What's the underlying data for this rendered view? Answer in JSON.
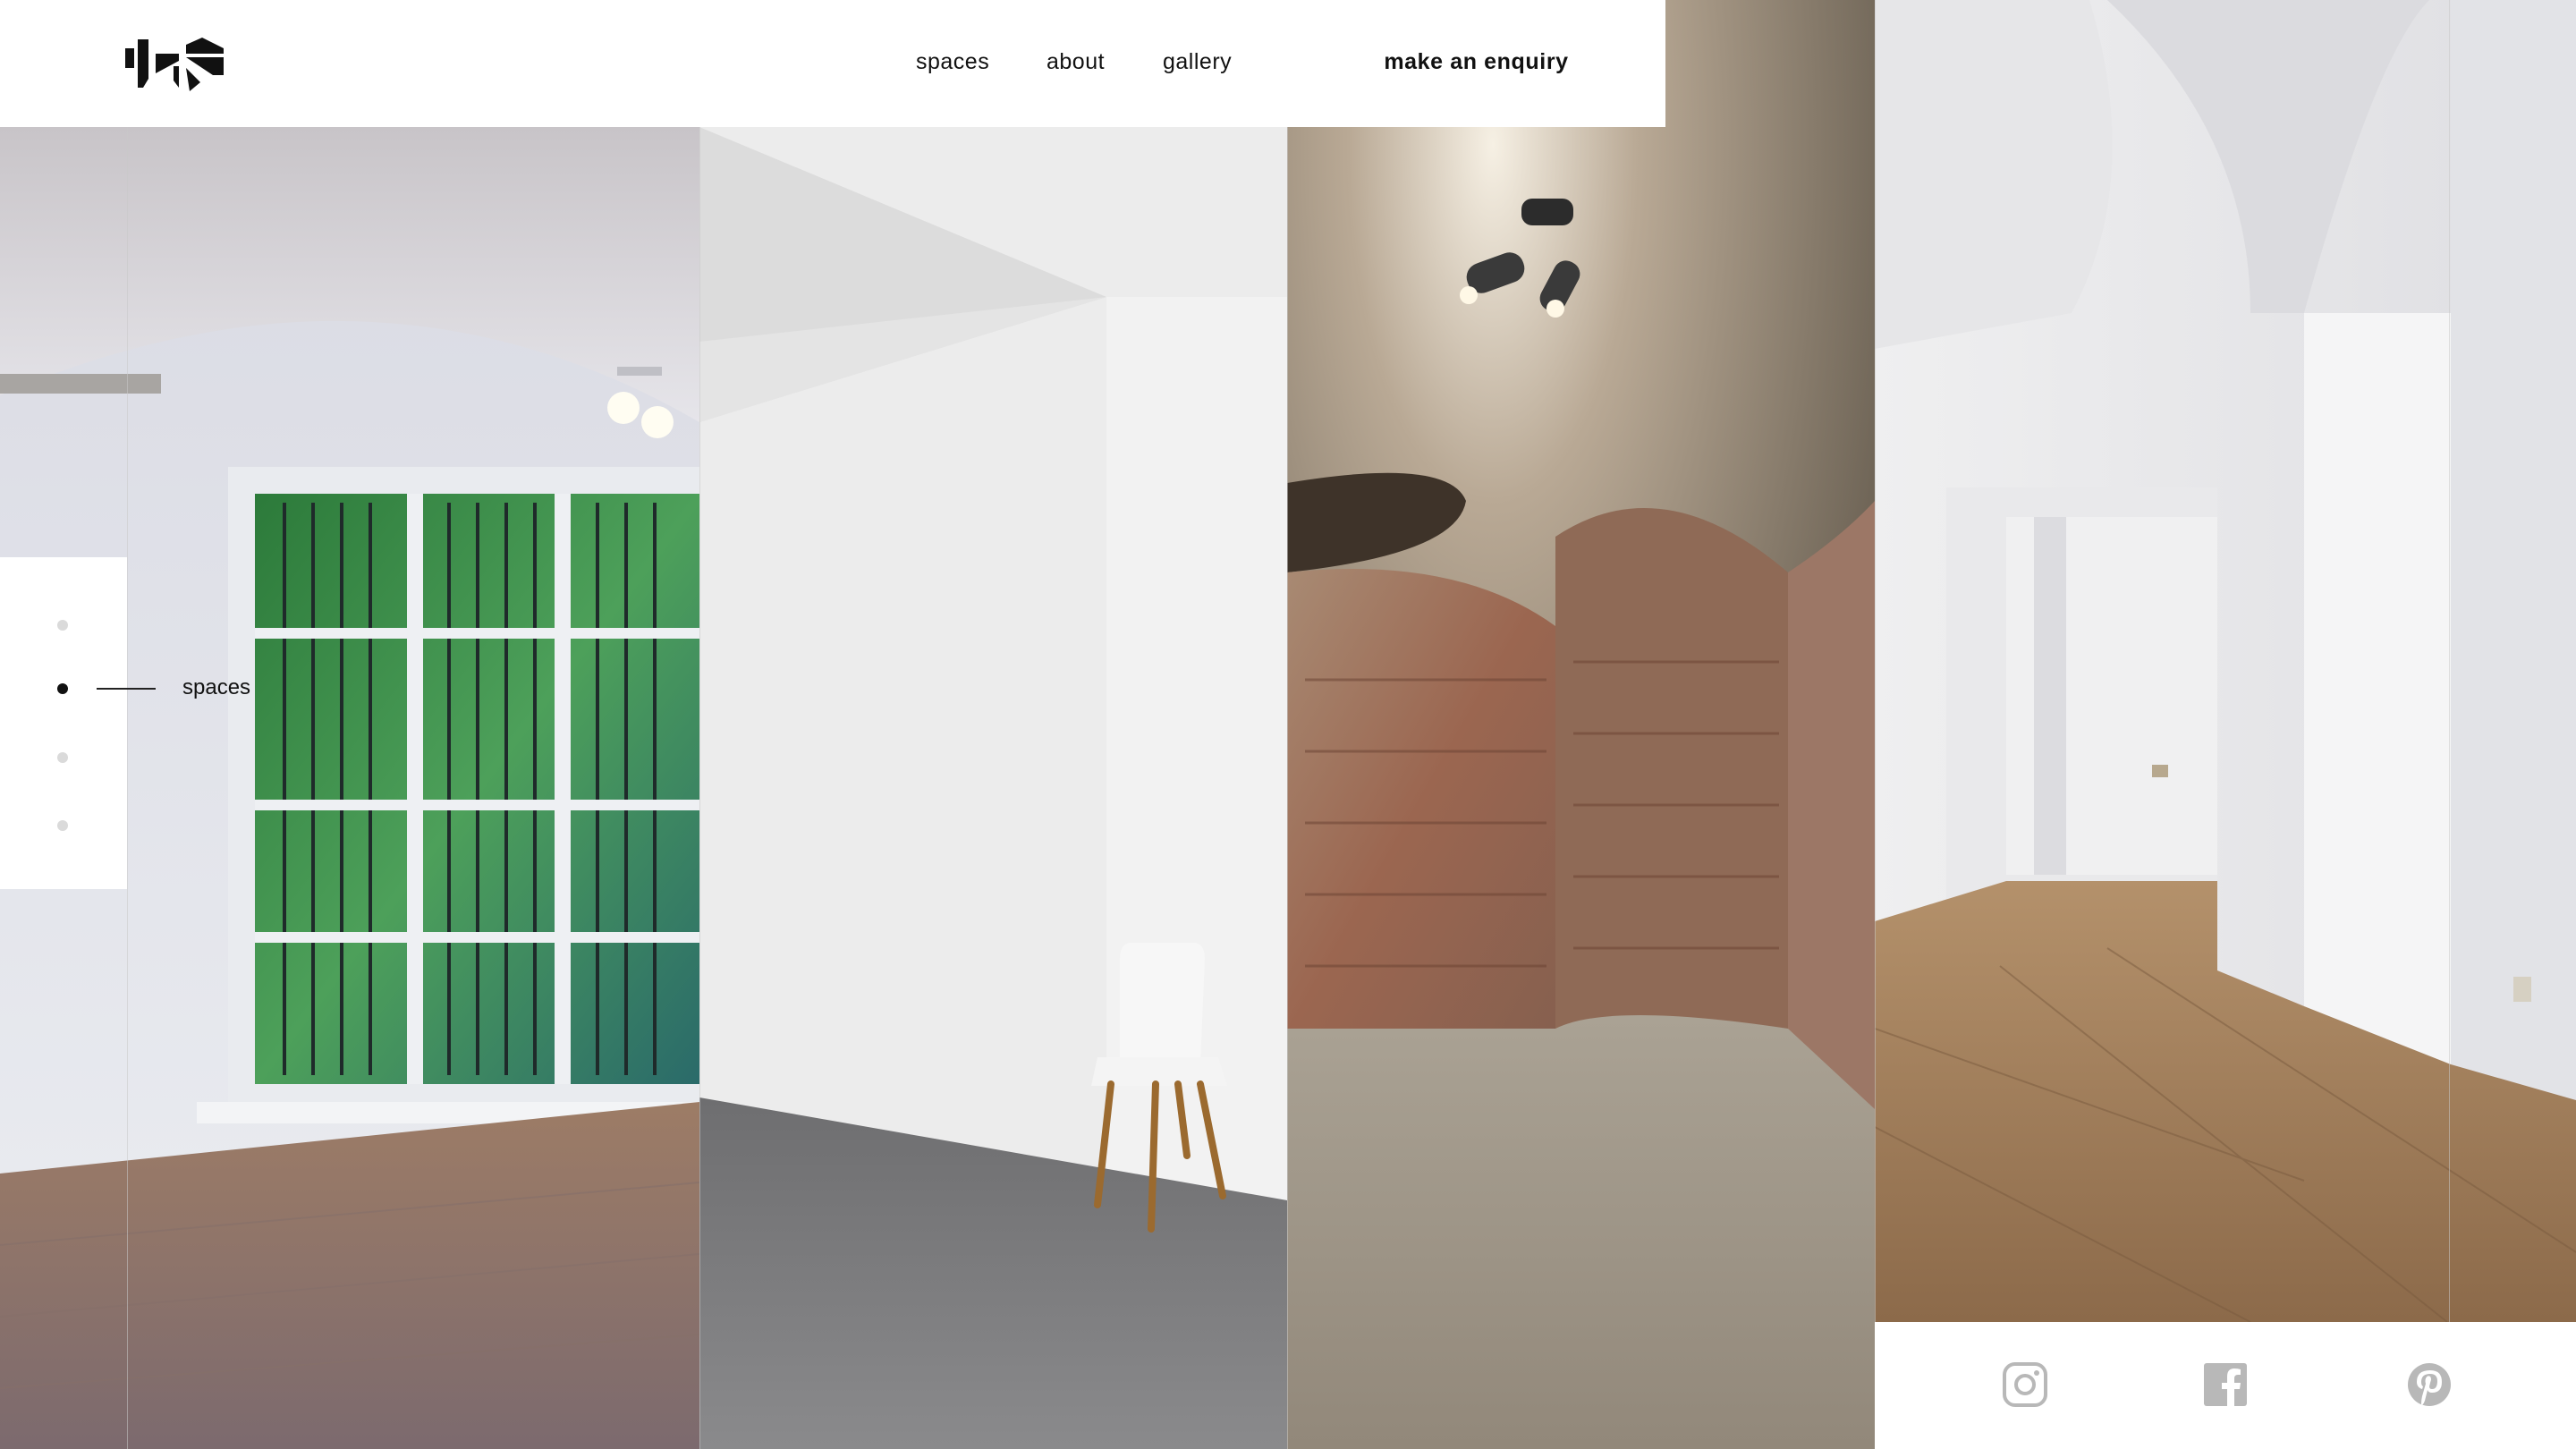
{
  "brand": {
    "logo_name": "Spazio gallery logo"
  },
  "nav": {
    "items": [
      {
        "label": "spaces"
      },
      {
        "label": "about"
      },
      {
        "label": "gallery"
      }
    ],
    "cta_label": "make an enquiry"
  },
  "pagination": {
    "dot_count": 4,
    "active_index": 1,
    "active_label": "spaces"
  },
  "panels": [
    {
      "subject": "room with arched ceiling, barred window and wooden floor"
    },
    {
      "subject": "white wall with single white chair on concrete floor"
    },
    {
      "subject": "vaulted brick cellar with ceiling spotlight"
    },
    {
      "subject": "white room with archway, doorway and wooden floor"
    }
  ],
  "social": {
    "icons": [
      "instagram-icon",
      "facebook-icon",
      "pinterest-icon"
    ],
    "icon_color": "#b8b8b8"
  },
  "colors": {
    "text": "#111111",
    "background": "#ffffff"
  }
}
